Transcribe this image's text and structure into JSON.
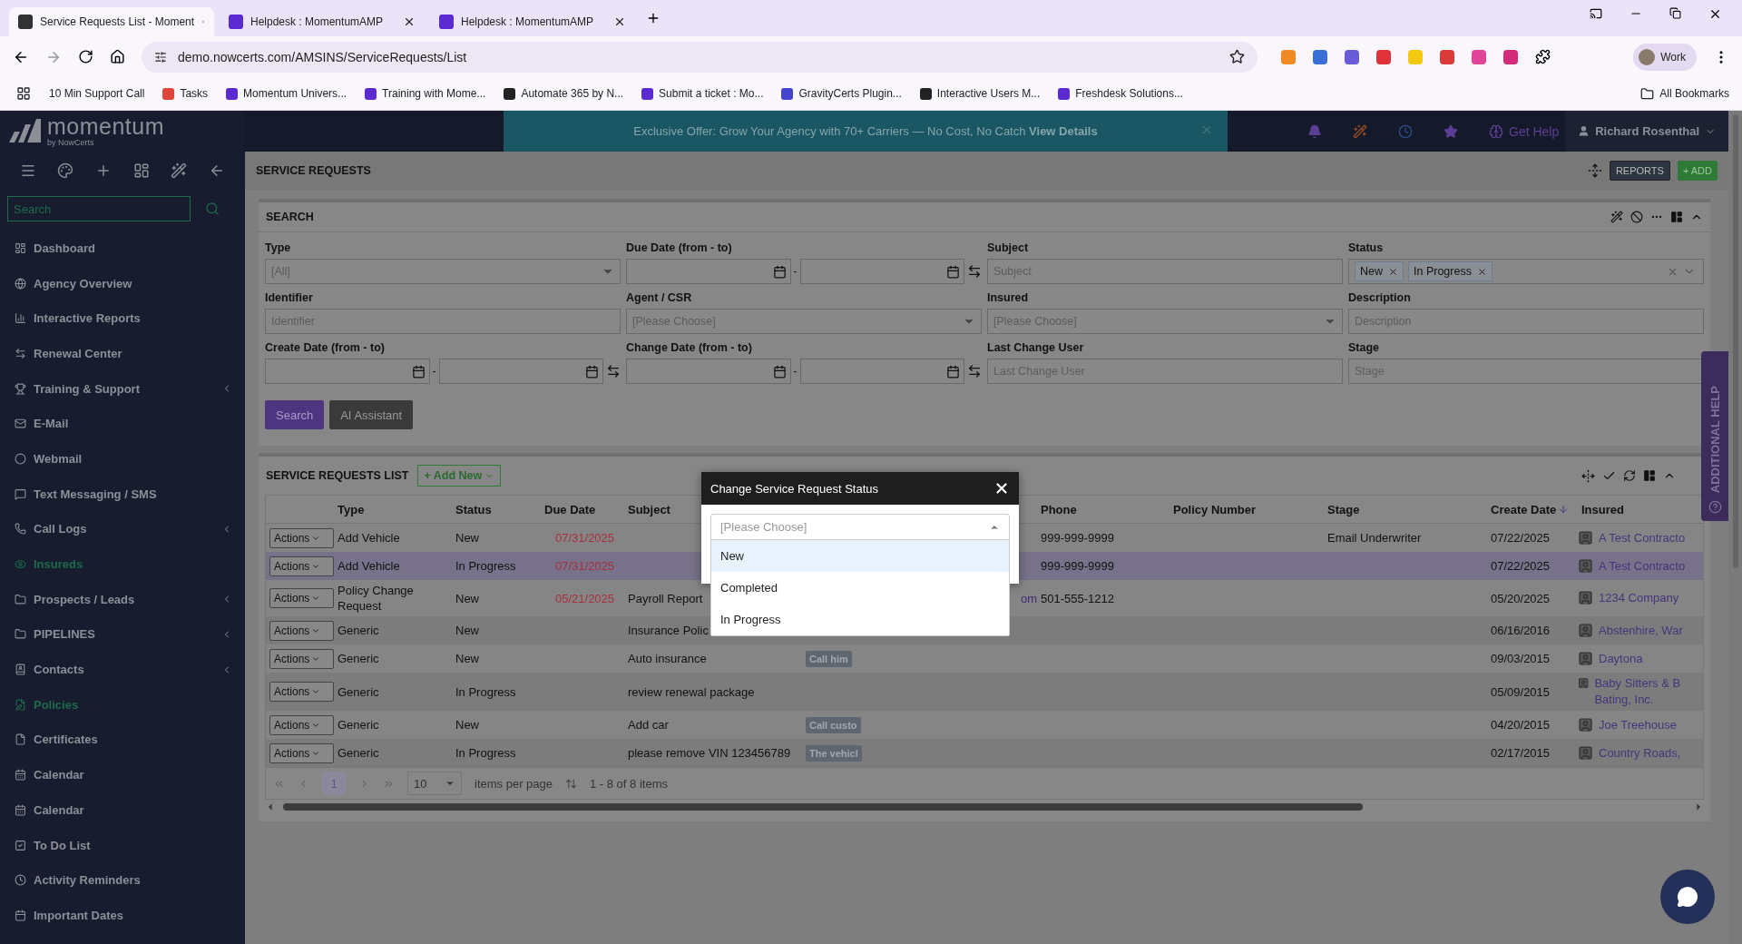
{
  "browser": {
    "tabs": [
      {
        "title": "Service Requests List - Moment",
        "selected": true
      },
      {
        "title": "Helpdesk : MomentumAMP",
        "selected": false
      },
      {
        "title": "Helpdesk : MomentumAMP",
        "selected": false
      }
    ],
    "address": "demo.nowcerts.com/AMSINS/ServiceRequests/List",
    "profile": "Work",
    "bookmarks": [
      "10 Min Support Call",
      "Tasks",
      "Momentum Univers...",
      "Training with Mome...",
      "Automate 365 by N...",
      "Submit a ticket : Mo...",
      "GravityCerts Plugin...",
      "Interactive Users M...",
      "Freshdesk Solutions..."
    ],
    "all_bookmarks": "All Bookmarks"
  },
  "header": {
    "banner": "Exclusive Offer: Grow Your Agency with 70+ Carriers — No Cost, No Catch **View Details**",
    "help": "Get Help",
    "user": "Richard Rosenthal"
  },
  "sidebar": {
    "logo": "momentum",
    "logo_sub": "by NowCerts",
    "search_placeholder": "Search",
    "items": [
      {
        "label": "Dashboard",
        "active": false,
        "expandable": false
      },
      {
        "label": "Agency Overview",
        "active": false,
        "expandable": false
      },
      {
        "label": "Interactive Reports",
        "active": false,
        "expandable": false
      },
      {
        "label": "Renewal Center",
        "active": false,
        "expandable": false
      },
      {
        "label": "Training & Support",
        "active": false,
        "expandable": true
      },
      {
        "label": "E-Mail",
        "active": false,
        "expandable": false
      },
      {
        "label": "Webmail",
        "active": false,
        "expandable": false
      },
      {
        "label": "Text Messaging / SMS",
        "active": false,
        "expandable": false
      },
      {
        "label": "Call Logs",
        "active": false,
        "expandable": true
      },
      {
        "label": "Insureds",
        "active": true,
        "expandable": false
      },
      {
        "label": "Prospects / Leads",
        "active": false,
        "expandable": true
      },
      {
        "label": "PIPELINES",
        "active": false,
        "expandable": true
      },
      {
        "label": "Contacts",
        "active": false,
        "expandable": true
      },
      {
        "label": "Policies",
        "active": true,
        "expandable": false
      },
      {
        "label": "Certificates",
        "active": false,
        "expandable": false
      },
      {
        "label": "Calendar",
        "active": false,
        "expandable": false
      },
      {
        "label": "Calendar",
        "active": false,
        "expandable": false
      },
      {
        "label": "To Do List",
        "active": false,
        "expandable": false
      },
      {
        "label": "Activity Reminders",
        "active": false,
        "expandable": false
      },
      {
        "label": "Important Dates",
        "active": false,
        "expandable": false
      }
    ]
  },
  "page_title": "SERVICE REQUESTS",
  "reports_button": "REPORTS",
  "add_button": "+ ADD",
  "search_panel": {
    "title": "SEARCH",
    "fields": [
      {
        "kind": "select",
        "label": "Type",
        "value": "[All]"
      },
      {
        "kind": "date_range",
        "label": "Due Date (from - to)",
        "separator": "-"
      },
      {
        "kind": "text",
        "label": "Subject",
        "placeholder": "Subject"
      },
      {
        "kind": "tags",
        "label": "Status",
        "tags": [
          "New",
          "In Progress"
        ]
      },
      {
        "kind": "text",
        "label": "Identifier",
        "placeholder": "Identifier"
      },
      {
        "kind": "select",
        "label": "Agent / CSR",
        "value": "[Please Choose]"
      },
      {
        "kind": "select",
        "label": "Insured",
        "value": "[Please Choose]"
      },
      {
        "kind": "text",
        "label": "Description",
        "placeholder": "Description"
      },
      {
        "kind": "date_range",
        "label": "Create Date (from - to)",
        "separator": "-"
      },
      {
        "kind": "date_range",
        "label": "Change Date (from - to)",
        "separator": "-"
      },
      {
        "kind": "text",
        "label": "Last Change User",
        "placeholder": "Last Change User"
      },
      {
        "kind": "text",
        "label": "Stage",
        "placeholder": "Stage"
      }
    ],
    "buttons": [
      {
        "label": "Search",
        "kind": "primary"
      },
      {
        "label": "AI Assistant",
        "kind": "secondary"
      }
    ]
  },
  "list": {
    "title": "SERVICE REQUESTS LIST",
    "add_button": "+ Add New",
    "columns": [
      {
        "label": "Type",
        "sorted_desc": false
      },
      {
        "label": "Status",
        "sorted_desc": false
      },
      {
        "label": "Due Date",
        "sorted_desc": false
      },
      {
        "label": "Subject",
        "sorted_desc": false
      },
      {
        "label": "Phone",
        "sorted_desc": false
      },
      {
        "label": "Policy Number",
        "sorted_desc": false
      },
      {
        "label": "Stage",
        "sorted_desc": false
      },
      {
        "label": "Create Date",
        "sorted_desc": true
      },
      {
        "label": "Insured",
        "sorted_desc": false
      }
    ],
    "rows": [
      {
        "action": "Actions",
        "type": "Add Vehicle",
        "status": "New",
        "due": "07/31/2025",
        "subject": "",
        "phone": "999-999-9999",
        "stage": "Email Underwriter",
        "created": "07/22/2025",
        "insured": "A Test Contracto",
        "selected": false
      },
      {
        "action": "Actions",
        "type": "Add Vehicle",
        "status": "In Progress",
        "due": "07/31/2025",
        "subject": "",
        "phone": "999-999-9999",
        "stage": "",
        "created": "07/22/2025",
        "insured": "A Test Contracto",
        "selected": true
      },
      {
        "action": "Actions",
        "type": "Policy Change Request",
        "status": "New",
        "due": "05/21/2025",
        "subject": "Payroll Report",
        "email": "om",
        "phone": "501-555-1212",
        "stage": "",
        "created": "05/20/2025",
        "insured": "1234 Company",
        "selected": false
      },
      {
        "action": "Actions",
        "type": "Generic",
        "status": "New",
        "due": "",
        "subject": "Insurance Polic",
        "phone": "",
        "stage": "",
        "created": "06/16/2016",
        "insured": "Abstenhire, War",
        "selected": false
      },
      {
        "action": "Actions",
        "type": "Generic",
        "status": "New",
        "due": "",
        "subject": "Auto insurance",
        "note": "Call him",
        "phone": "",
        "stage": "",
        "created": "09/03/2015",
        "insured": "Daytona",
        "selected": false
      },
      {
        "action": "Actions",
        "type": "Generic",
        "status": "In Progress",
        "due": "",
        "subject": "review renewal package",
        "phone": "",
        "stage": "",
        "created": "05/09/2015",
        "insured": "Baby Sitters & B Bating, Inc.",
        "selected": false
      },
      {
        "action": "Actions",
        "type": "Generic",
        "status": "New",
        "due": "",
        "subject": "Add car",
        "note": "Call custo",
        "phone": "",
        "stage": "",
        "created": "04/20/2015",
        "insured": "Joe Treehouse",
        "selected": false
      },
      {
        "action": "Actions",
        "type": "Generic",
        "status": "In Progress",
        "due": "",
        "subject": "please remove VIN 123456789",
        "note": "The vehicl",
        "phone": "",
        "stage": "",
        "created": "02/17/2015",
        "insured": "Country Roads,",
        "selected": false
      }
    ],
    "pager": {
      "pages": [
        {
          "label": "1",
          "selected": true
        }
      ],
      "page_size": "10",
      "page_size_label": "items per page",
      "summary": "1 - 8 of 8 items"
    }
  },
  "modal": {
    "title": "Change Service Request Status",
    "placeholder": "[Please Choose]",
    "options": [
      {
        "label": "New",
        "highlighted": true
      },
      {
        "label": "Completed",
        "highlighted": false
      },
      {
        "label": "In Progress",
        "highlighted": false
      }
    ]
  },
  "side_tab": "ADDITIONAL HELP"
}
